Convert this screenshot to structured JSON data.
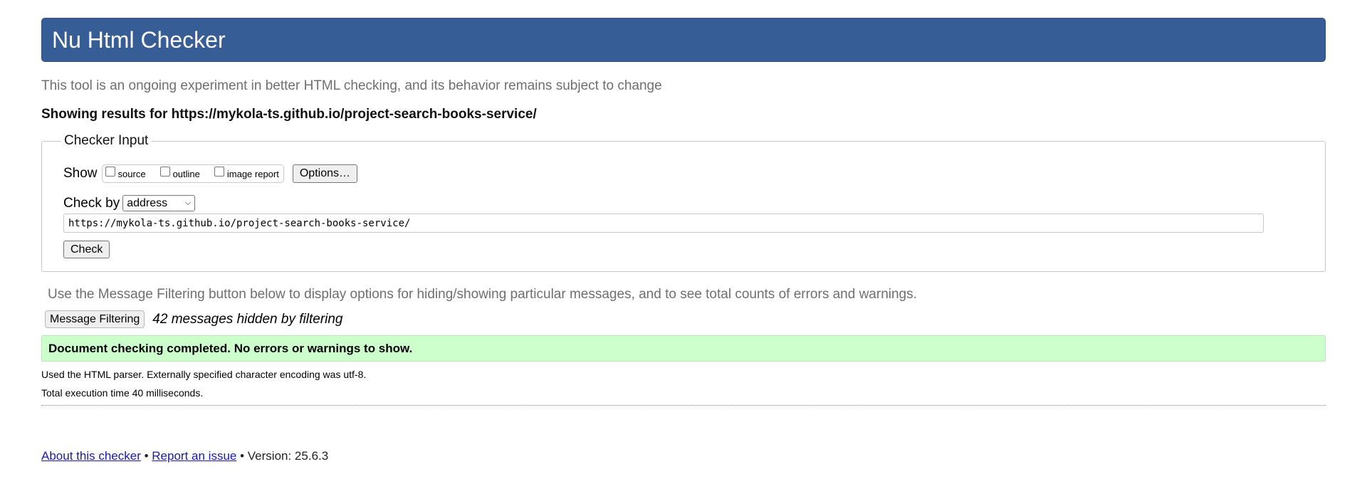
{
  "header": {
    "title": "Nu Html Checker"
  },
  "intro_text": "This tool is an ongoing experiment in better HTML checking, and its behavior remains subject to change",
  "results_for": "Showing results for https://mykola-ts.github.io/project-search-books-service/",
  "checker_input": {
    "legend": "Checker Input",
    "show_label": "Show",
    "show_options": [
      {
        "label": "source",
        "checked": false
      },
      {
        "label": "outline",
        "checked": false
      },
      {
        "label": "image report",
        "checked": false
      }
    ],
    "options_button": "Options…",
    "check_by_label": "Check by",
    "check_by_value": "address",
    "url_value": "https://mykola-ts.github.io/project-search-books-service/",
    "check_button": "Check"
  },
  "filtering": {
    "note": "Use the Message Filtering button below to display options for hiding/showing particular messages, and to see total counts of errors and warnings.",
    "button": "Message Filtering",
    "hidden_count_text": "42 messages hidden by filtering"
  },
  "status": {
    "message": "Document checking completed. No errors or warnings to show.",
    "color": "#ccffcc"
  },
  "details": {
    "parser_line": "Used the HTML parser. Externally specified character encoding was utf-8.",
    "time_line": "Total execution time 40 milliseconds."
  },
  "footer": {
    "about_link": "About this checker",
    "separator": "•",
    "report_link": "Report an issue",
    "version_text": "Version: 25.6.3"
  },
  "colors": {
    "header_bg": "#365d95",
    "link": "#1a1aa6"
  }
}
